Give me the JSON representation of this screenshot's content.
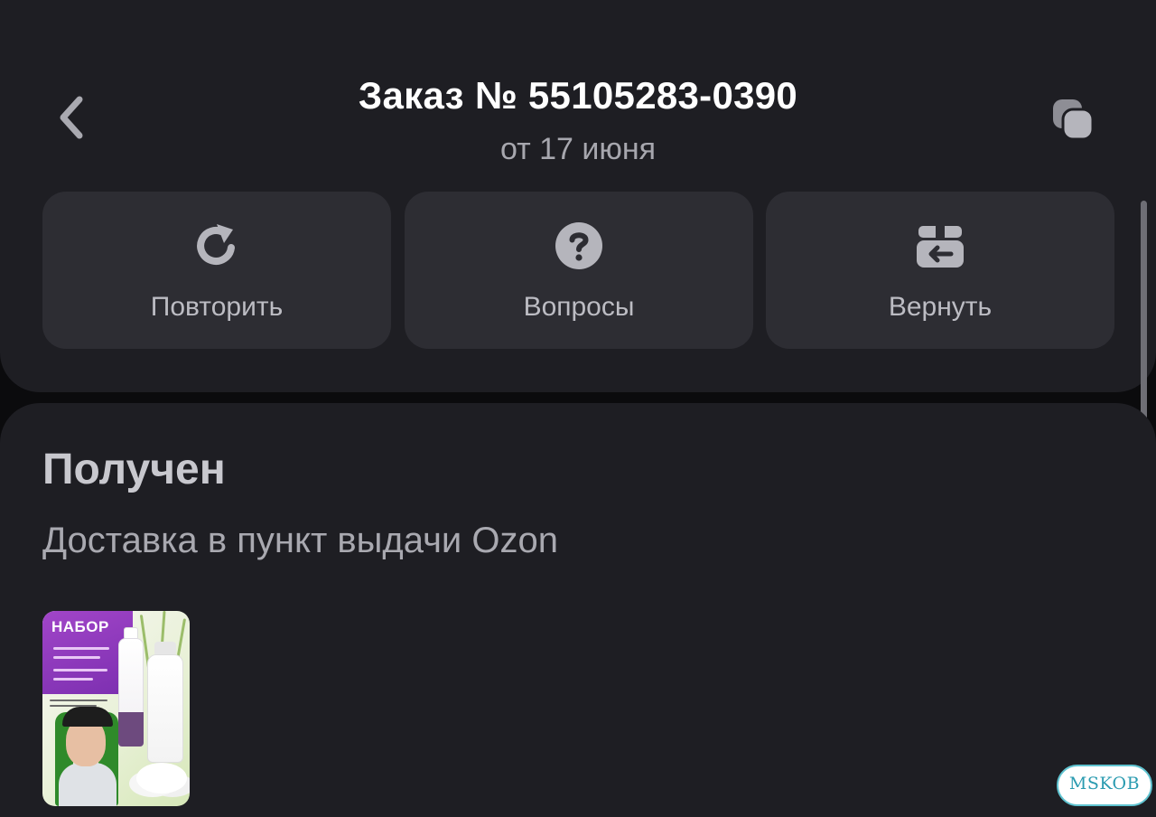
{
  "header": {
    "order_title": "Заказ № 55105283-0390",
    "order_date": "от 17 июня",
    "back_icon": "chevron-left-icon",
    "copy_icon": "copy-icon"
  },
  "actions": [
    {
      "label": "Повторить",
      "icon": "repeat-icon"
    },
    {
      "label": "Вопросы",
      "icon": "question-circle-icon"
    },
    {
      "label": "Вернуть",
      "icon": "return-box-icon"
    }
  ],
  "status": {
    "title": "Получен",
    "delivery": "Доставка в пункт выдачи Ozon"
  },
  "product": {
    "thumbnail_heading": "НАБОР"
  },
  "watermark": {
    "text": "MSKOB"
  },
  "colors": {
    "background": "#1e1e23",
    "button_background": "#2d2d33",
    "accent_blue": "#1f5cf5",
    "icon_gray": "#b5b5bc"
  }
}
